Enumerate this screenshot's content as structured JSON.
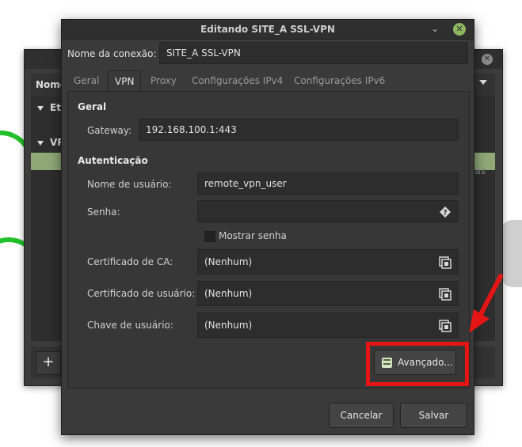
{
  "background_window": {
    "header_label": "Nome",
    "groups": [
      {
        "label": "Eth"
      },
      {
        "label": "VP"
      }
    ],
    "side_text": "trás",
    "add_button": "+"
  },
  "dialog": {
    "title": "Editando SITE_A SSL-VPN",
    "window_controls": {
      "minimize_icon": "minimize-icon",
      "close_icon": "close-icon"
    },
    "connection_name_label": "Nome da conexão:",
    "connection_name_value": "SITE_A SSL-VPN",
    "tabs": [
      {
        "label": "Geral",
        "active": false
      },
      {
        "label": "VPN",
        "active": true
      },
      {
        "label": "Proxy",
        "active": false
      },
      {
        "label": "Configurações IPv4",
        "active": false
      },
      {
        "label": "Configurações IPv6",
        "active": false
      }
    ],
    "sections": {
      "general": "Geral",
      "auth": "Autenticação"
    },
    "fields": {
      "gateway_label": "Gateway:",
      "gateway_value": "192.168.100.1:443",
      "username_label": "Nome de usuário:",
      "username_value": "remote_vpn_user",
      "password_label": "Senha:",
      "password_value": "",
      "show_password_label": "Mostrar senha",
      "ca_cert_label": "Certificado de CA:",
      "ca_cert_value": "(Nenhum)",
      "user_cert_label": "Certificado de usuário:",
      "user_cert_value": "(Nenhum)",
      "user_key_label": "Chave de usuário:",
      "user_key_value": "(Nenhum)"
    },
    "advanced_button": "Avançado...",
    "cancel_button": "Cancelar",
    "save_button": "Salvar"
  },
  "colors": {
    "highlight_box": "#e41515",
    "selection_green": "#8fa876",
    "close_button_green": "#8cb85f"
  }
}
